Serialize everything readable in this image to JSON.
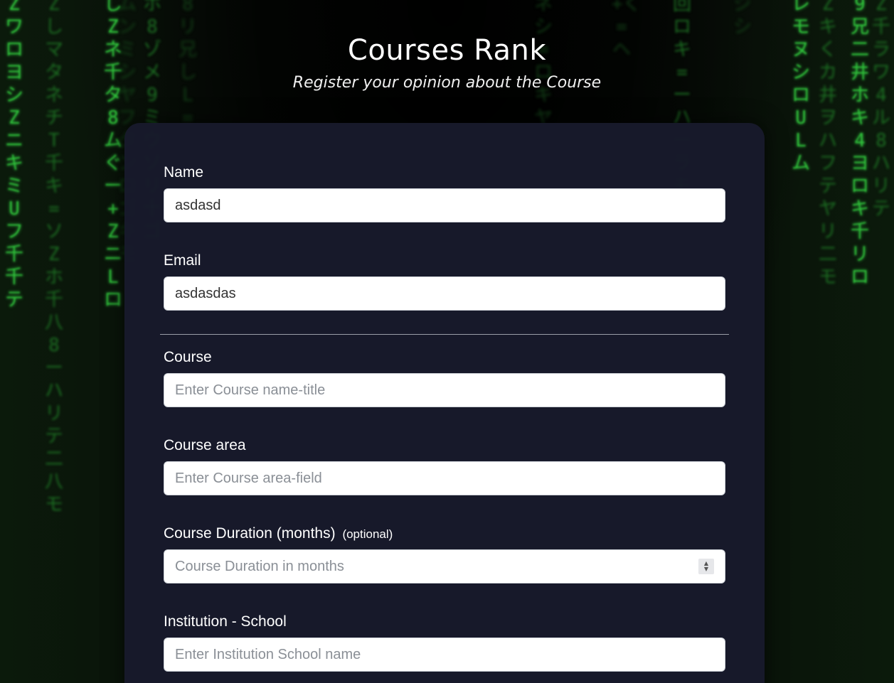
{
  "header": {
    "title": "Courses Rank",
    "subtitle": "Register your opinion about the Course"
  },
  "form": {
    "name": {
      "label": "Name",
      "value": "asdasd"
    },
    "email": {
      "label": "Email",
      "value": "asdasdas"
    },
    "course": {
      "label": "Course",
      "placeholder": "Enter Course name-title",
      "value": ""
    },
    "course_area": {
      "label": "Course area",
      "placeholder": "Enter Course area-field",
      "value": ""
    },
    "course_duration": {
      "label": "Course Duration (months)",
      "optional": "(optional)",
      "placeholder": "Course Duration in months",
      "value": ""
    },
    "institution": {
      "label": "Institution - School",
      "placeholder": "Enter Institution School name",
      "value": ""
    }
  },
  "colors": {
    "card_background": "#181a2c",
    "matrix_green": "#2fbf3a",
    "input_background": "#ffffff"
  }
}
